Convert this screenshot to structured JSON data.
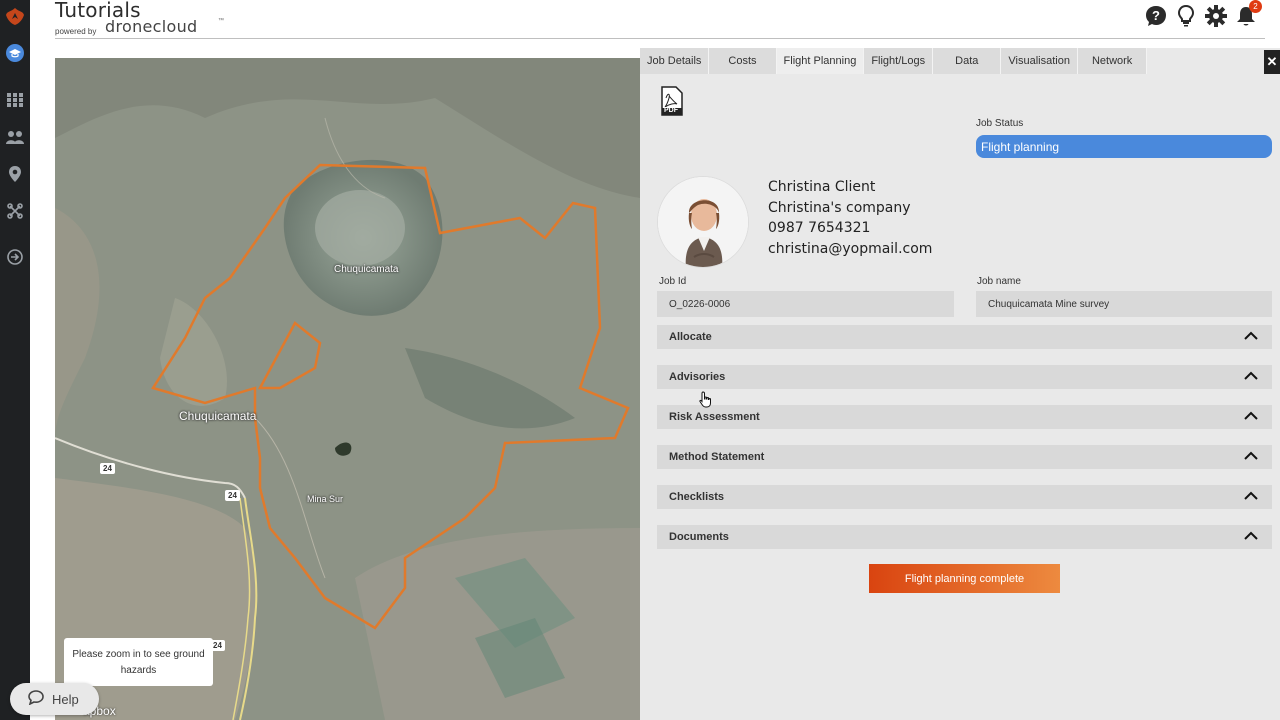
{
  "header": {
    "title": "Tutorials",
    "powered_by": "powered by",
    "brand": "dronecloud",
    "trademark": "™",
    "notification_count": "2"
  },
  "rail": {
    "icons": [
      "logo-icon",
      "graduation-cap-icon",
      "grid-icon",
      "team-icon",
      "map-pin-icon",
      "drone-icon",
      "logout-icon"
    ]
  },
  "map": {
    "labels": {
      "pit": "Chuquicamata",
      "town": "Chuquicamata",
      "mina_sur": "Mina Sur",
      "route_a": "24",
      "route_b": "24",
      "route_c": "24"
    },
    "zoom_tip": "Please zoom in to see ground hazards",
    "attribution": "apbox",
    "help_label": "Help",
    "boundary_color": "#e07a2c"
  },
  "panel": {
    "tabs": [
      {
        "label": "Job Details",
        "active": false
      },
      {
        "label": "Costs",
        "active": false
      },
      {
        "label": "Flight Planning",
        "active": true
      },
      {
        "label": "Flight/Logs",
        "active": false
      },
      {
        "label": "Data",
        "active": false
      },
      {
        "label": "Visualisation",
        "active": false
      },
      {
        "label": "Network",
        "active": false
      }
    ],
    "close_label": "✕",
    "pdf_label": "PDF",
    "job_status_label": "Job Status",
    "job_status_value": "Flight planning",
    "contact": {
      "name": "Christina Client",
      "company": "Christina's company",
      "phone": "0987 7654321",
      "email": "christina@yopmail.com"
    },
    "job_id_label": "Job Id",
    "job_id_value": "O_0226-0006",
    "job_name_label": "Job name",
    "job_name_value": "Chuquicamata Mine survey",
    "sections": [
      "Allocate",
      "Advisories",
      "Risk Assessment",
      "Method Statement",
      "Checklists",
      "Documents"
    ],
    "complete_button": "Flight planning complete"
  },
  "colors": {
    "accent_blue": "#4a89dc",
    "button_orange_start": "#d94410",
    "button_orange_end": "#ed8a3f",
    "badge_red": "#e03b12"
  }
}
